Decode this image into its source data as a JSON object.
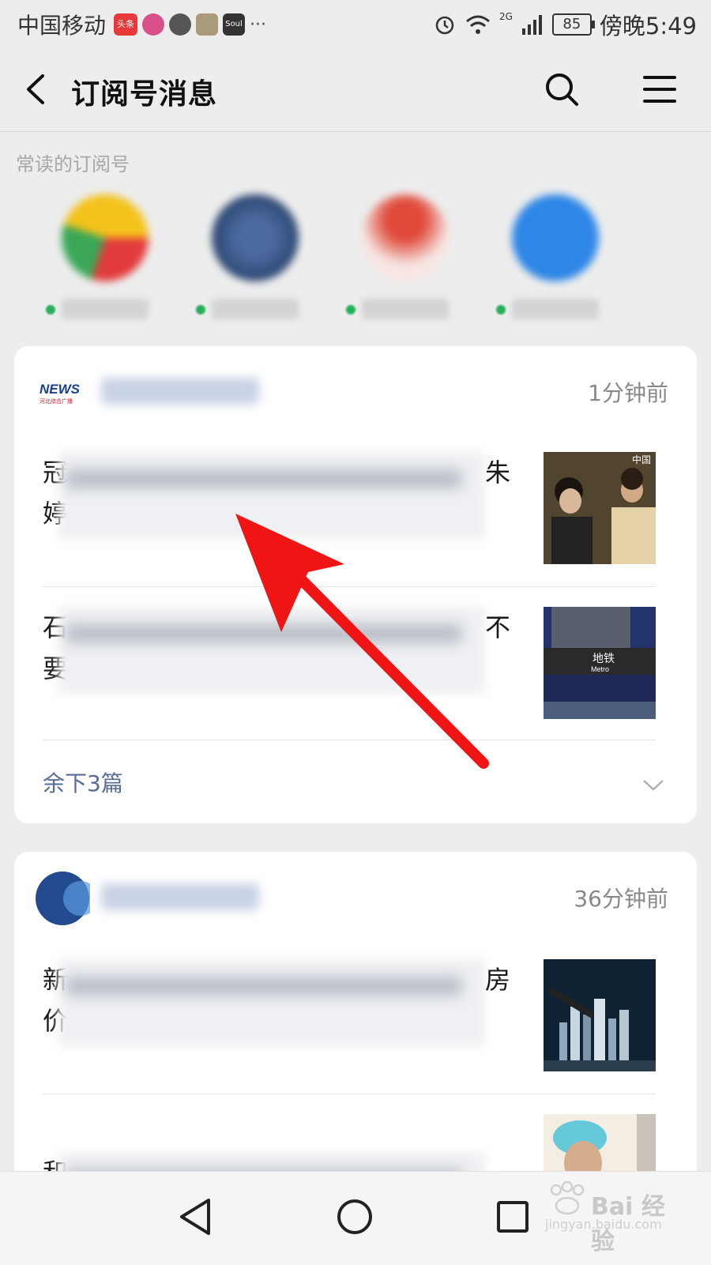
{
  "status_bar": {
    "carrier": "中国移动",
    "time": "傍晚5:49",
    "battery": "85",
    "network": "2G",
    "notifications": [
      "头条",
      "···"
    ]
  },
  "nav": {
    "title": "订阅号消息"
  },
  "frequent_section": {
    "label": "常读的订阅号"
  },
  "cards": [
    {
      "time_ago": "1分钟前",
      "articles": [
        {
          "title_start": "冠",
          "title_end": "朱",
          "line2_start": "婷"
        },
        {
          "title_start": "石",
          "title_end": "不",
          "line2_start": "要"
        }
      ],
      "more_label": "余下3篇",
      "logo_text": "NEWS",
      "logo_sub": "河北综合广播"
    },
    {
      "time_ago": "36分钟前",
      "articles": [
        {
          "title_start": "新",
          "title_end": "房",
          "line2_start": "价"
        },
        {
          "title_start": "和",
          "title_end": "",
          "line2_start": ""
        }
      ]
    }
  ],
  "thumb_labels": {
    "metro_cn": "地铁",
    "metro_en": "Metro",
    "corner_text": "中国"
  },
  "watermark": {
    "text": "Bai 经验",
    "sub": "jingyan.baidu.com"
  }
}
